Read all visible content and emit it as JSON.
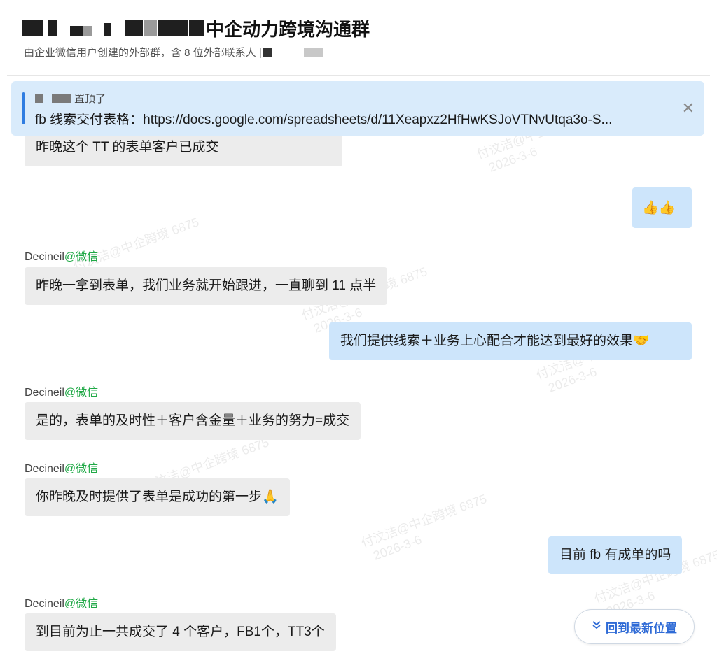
{
  "header": {
    "title": "中企动力跨境沟通群",
    "subtitle": "由企业微信用户创建的外部群，含 8 位外部联系人 |"
  },
  "pinned": {
    "label": "置顶了",
    "text": "fb 线索交付表格：https://docs.google.com/spreadsheets/d/11Xeapxz2HfHwKSJoVTNvUtqa3o-S...",
    "close_icon": "close-icon"
  },
  "watermark": {
    "line1": "付汶洁@中企跨境 6875",
    "line2": "2026-3-6"
  },
  "messages": [
    {
      "dir": "in",
      "sender": "",
      "text": "昨晚这个 TT 的表单客户已成交"
    },
    {
      "dir": "out",
      "sender": "",
      "text": "👍👍"
    },
    {
      "dir": "in",
      "sender": "Decineil",
      "source": "@微信",
      "text": "昨晚一拿到表单，我们业务就开始跟进，一直聊到 11 点半"
    },
    {
      "dir": "out",
      "sender": "",
      "text": "我们提供线索＋业务上心配合才能达到最好的效果🤝"
    },
    {
      "dir": "in",
      "sender": "Decineil",
      "source": "@微信",
      "text": "是的，表单的及时性＋客户含金量＋业务的努力=成交"
    },
    {
      "dir": "in",
      "sender": "Decineil",
      "source": "@微信",
      "text": "你昨晚及时提供了表单是成功的第一步🙏"
    },
    {
      "dir": "out",
      "sender": "",
      "text": "目前 fb 有成单的吗"
    },
    {
      "dir": "in",
      "sender": "Decineil",
      "source": "@微信",
      "text": "到目前为止一共成交了 4 个客户，FB1个，TT3个"
    }
  ],
  "jump_button": {
    "label": "回到最新位置",
    "icon": "double-chevron-down-icon"
  },
  "colors": {
    "incoming_bubble": "#ececec",
    "outgoing_bubble": "#cde5fb",
    "pinned_background": "#d9ebfb",
    "wechat_source": "#1ea845",
    "accent": "#2f6bd6"
  }
}
